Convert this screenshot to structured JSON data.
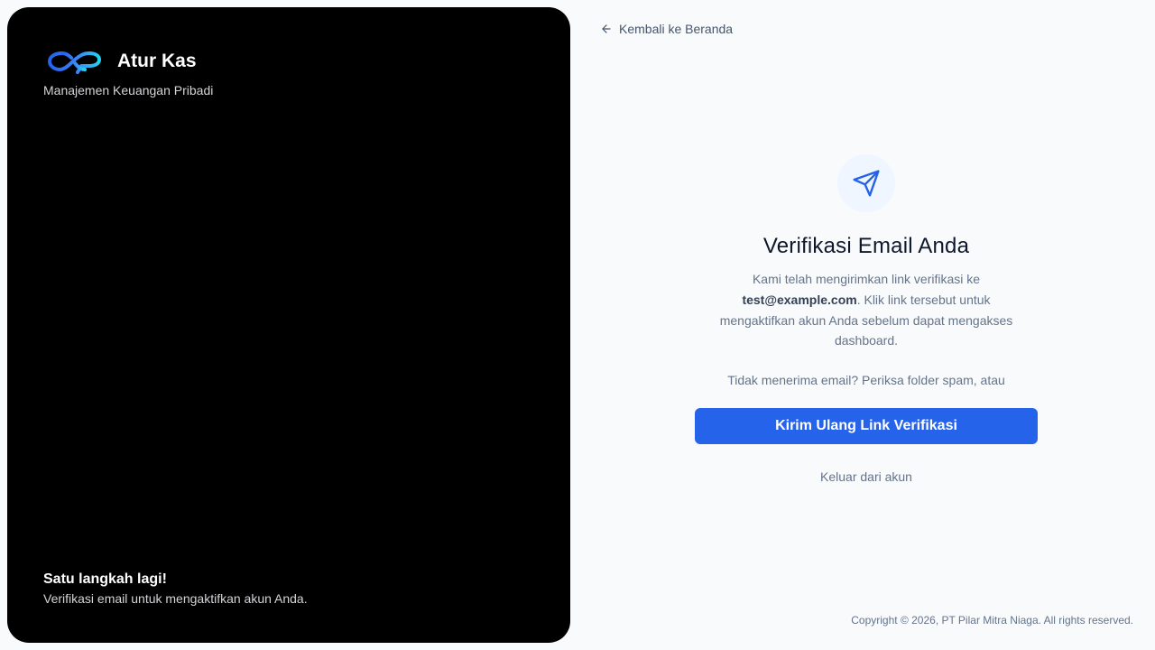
{
  "brand": {
    "name": "Atur Kas",
    "tagline": "Manajemen Keuangan Pribadi",
    "logo_icon": "infinity-logo-icon"
  },
  "left_footer": {
    "title": "Satu langkah lagi!",
    "text": "Verifikasi email untuk mengaktifkan akun Anda."
  },
  "nav": {
    "back_label": "Kembali ke Beranda",
    "back_icon": "arrow-left-icon"
  },
  "verify": {
    "icon": "send-icon",
    "heading": "Verifikasi Email Anda",
    "desc_before": "Kami telah mengirimkan link verifikasi ke",
    "email": "test@example.com",
    "desc_after": ". Klik link tersebut untuk mengaktifkan akun Anda sebelum dapat mengakses dashboard.",
    "hint": "Tidak menerima email? Periksa folder spam, atau",
    "resend_label": "Kirim Ulang Link Verifikasi",
    "logout_label": "Keluar dari akun"
  },
  "footer": {
    "copyright": "Copyright © 2026, PT Pilar Mitra Niaga. All rights reserved."
  },
  "colors": {
    "accent": "#2563eb",
    "panel_bg": "#000000",
    "page_bg": "#f8fafc",
    "icon_bg": "#eff6ff"
  }
}
